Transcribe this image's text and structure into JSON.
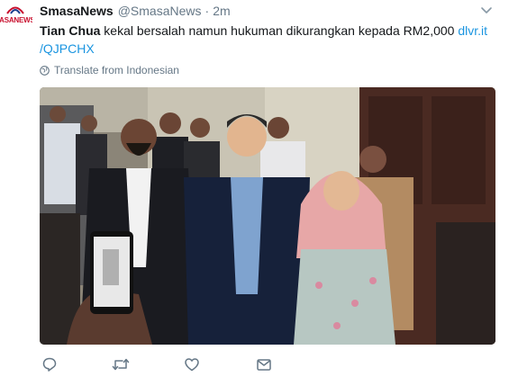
{
  "avatar": {
    "logo_text": "SASANEWS"
  },
  "tweet": {
    "author_name": "SmasaNews",
    "handle": "@SmasaNews",
    "separator": "·",
    "time": "2m",
    "text_bold": "Tian Chua",
    "text_body": " kekal bersalah namun hukuman dikurangkan kepada RM2,000 ",
    "link_part1": "dlvr.it",
    "link_part2": "/QJPCHX",
    "translate_label": "Translate from Indonesian"
  },
  "actions": {
    "reply_icon": "reply-icon",
    "retweet_icon": "retweet-icon",
    "like_icon": "like-icon",
    "dm_icon": "direct-message-icon"
  },
  "colors": {
    "link": "#1b95e0",
    "text": "#14171a",
    "muted": "#657786",
    "brand": "#c8102e"
  }
}
